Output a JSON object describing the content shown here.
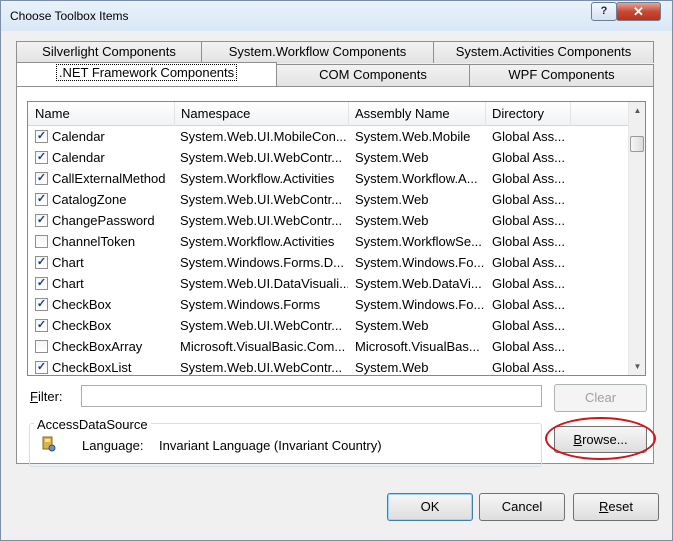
{
  "window": {
    "title": "Choose Toolbox Items",
    "help_glyph": "?",
    "close_glyph": "✕"
  },
  "tabs": {
    "row1": [
      {
        "label": "Silverlight Components"
      },
      {
        "label": "System.Workflow Components"
      },
      {
        "label": "System.Activities Components"
      }
    ],
    "row2": [
      {
        "label": ".NET Framework Components",
        "active": true
      },
      {
        "label": "COM Components"
      },
      {
        "label": "WPF Components"
      }
    ]
  },
  "list": {
    "columns": [
      "Name",
      "Namespace",
      "Assembly Name",
      "Directory"
    ],
    "rows": [
      {
        "checked": true,
        "name": "Calendar",
        "namespace": "System.Web.UI.MobileCon...",
        "assembly": "System.Web.Mobile",
        "directory": "Global Ass..."
      },
      {
        "checked": true,
        "name": "Calendar",
        "namespace": "System.Web.UI.WebContr...",
        "assembly": "System.Web",
        "directory": "Global Ass..."
      },
      {
        "checked": true,
        "name": "CallExternalMethod",
        "namespace": "System.Workflow.Activities",
        "assembly": "System.Workflow.A...",
        "directory": "Global Ass..."
      },
      {
        "checked": true,
        "name": "CatalogZone",
        "namespace": "System.Web.UI.WebContr...",
        "assembly": "System.Web",
        "directory": "Global Ass..."
      },
      {
        "checked": true,
        "name": "ChangePassword",
        "namespace": "System.Web.UI.WebContr...",
        "assembly": "System.Web",
        "directory": "Global Ass..."
      },
      {
        "checked": false,
        "name": "ChannelToken",
        "namespace": "System.Workflow.Activities",
        "assembly": "System.WorkflowSe...",
        "directory": "Global Ass..."
      },
      {
        "checked": true,
        "name": "Chart",
        "namespace": "System.Windows.Forms.D...",
        "assembly": "System.Windows.Fo...",
        "directory": "Global Ass..."
      },
      {
        "checked": true,
        "name": "Chart",
        "namespace": "System.Web.UI.DataVisuali...",
        "assembly": "System.Web.DataVi...",
        "directory": "Global Ass..."
      },
      {
        "checked": true,
        "name": "CheckBox",
        "namespace": "System.Windows.Forms",
        "assembly": "System.Windows.Fo...",
        "directory": "Global Ass..."
      },
      {
        "checked": true,
        "name": "CheckBox",
        "namespace": "System.Web.UI.WebContr...",
        "assembly": "System.Web",
        "directory": "Global Ass..."
      },
      {
        "checked": false,
        "name": "CheckBoxArray",
        "namespace": "Microsoft.VisualBasic.Com...",
        "assembly": "Microsoft.VisualBas...",
        "directory": "Global Ass..."
      },
      {
        "checked": true,
        "name": "CheckBoxList",
        "namespace": "System.Web.UI.WebContr...",
        "assembly": "System.Web",
        "directory": "Global Ass..."
      }
    ],
    "check_glyph": "✓",
    "scroll_up_glyph": "▲",
    "scroll_down_glyph": "▼"
  },
  "filter": {
    "label_mnemonic": "F",
    "label_rest": "ilter:",
    "value": "",
    "clear_label": "Clear"
  },
  "details": {
    "group_title": "AccessDataSource",
    "language_label": "Language:",
    "language_value": "Invariant Language (Invariant Country)",
    "browse_mnemonic": "B",
    "browse_rest": "rowse..."
  },
  "footer": {
    "ok_label": "OK",
    "cancel_label": "Cancel",
    "reset_mnemonic": "R",
    "reset_rest": "eset"
  },
  "colors": {
    "annotation": "#d0151b",
    "title_bar": "#dbe8f6"
  }
}
